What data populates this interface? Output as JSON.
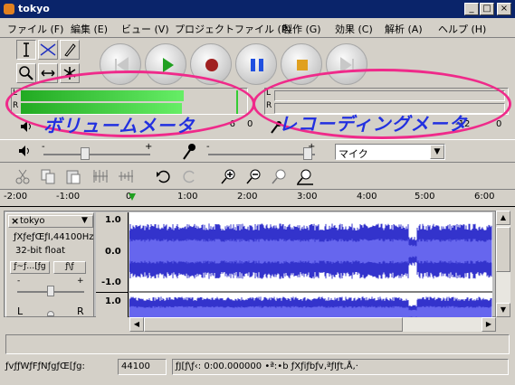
{
  "window": {
    "title": "tokyo"
  },
  "menu": [
    "ファイル (F)",
    "編集 (E)",
    "ビュー (V)",
    "プロジェクトファイル (P)",
    "製作 (G)",
    "効果 (C)",
    "解析 (A)",
    "ヘルプ (H)"
  ],
  "tools": {
    "selection": "selection-tool",
    "envelope": "envelope-tool",
    "draw": "draw-tool",
    "zoom": "zoom-tool",
    "timeshift": "timeshift-tool",
    "multi": "multi-tool"
  },
  "meters": {
    "playback": {
      "ticks": [
        "-6",
        "0"
      ],
      "left_level": 0.92,
      "right_level": 0.9
    },
    "record": {
      "ticks": [
        "-12",
        "0"
      ]
    }
  },
  "annotations": {
    "playback_meter": "ボリュームメータ",
    "record_meter": "レコーディングメータ"
  },
  "mixer": {
    "input_source": "マイク"
  },
  "ruler": {
    "labels": [
      "-2:00",
      "-1:00",
      "0",
      "1:00",
      "2:00",
      "3:00",
      "4:00",
      "5:00",
      "6:00"
    ]
  },
  "track": {
    "name": "tokyo",
    "info_line1": "ƒXƒeƒŒƒI,44100Hz",
    "info_line2": "32-bit float",
    "mute_label": "ƒ~ƒ…[ƒg",
    "solo_label": "ƒ\\ƒ",
    "pan_left": "L",
    "pan_right": "R",
    "gain_minus": "-",
    "gain_plus": "+",
    "scale": [
      "1.0",
      "0.0",
      "-1.0",
      "1.0"
    ]
  },
  "statusbar": {
    "rate_label": "ƒvƒƒWƒFƒNƒgƒŒ[ƒg:",
    "rate_value": "44100",
    "cursor_text": "ƒJ[ƒ\\ƒ‹: 0:00.000000 •ª:•b  ƒXƒiƒbƒv‚ªƒIƒt‚Å‚·"
  },
  "colors": {
    "waveform": "#3333cc",
    "waveform_light": "#6666ee",
    "meter_green": "#33cc33",
    "annotation": "#2230e0",
    "ellipse": "#ef2a8a"
  }
}
